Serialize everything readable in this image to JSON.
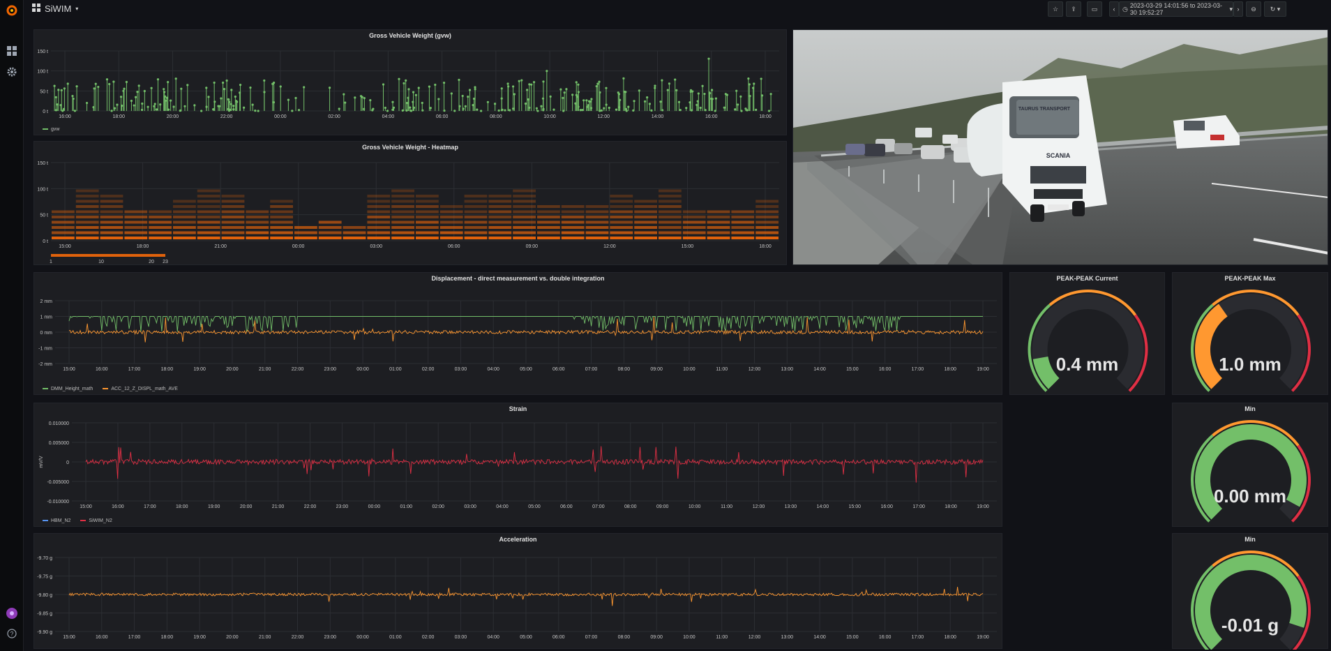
{
  "topbar": {
    "dashboard_title": "SiWIM",
    "time_range": "2023-03-29 14:01:56 to 2023-03-30 19:52:27"
  },
  "colors": {
    "green": "#73bf69",
    "orange": "#ff9830",
    "red": "#e02f44",
    "heat_orange": "#e0620c",
    "blue": "#5794f2"
  },
  "panels": {
    "gvw": {
      "title": "Gross Vehicle Weight (gvw)",
      "legend": [
        "gvw"
      ]
    },
    "heatmap": {
      "title": "Gross Vehicle Weight - Heatmap",
      "scale_labels": [
        "1",
        "10",
        "20",
        "23"
      ]
    },
    "displacement": {
      "title": "Displacement - direct measurement vs. double integration",
      "legend": [
        "DMM_Height_math",
        "ACC_12_Z_DISPL_math_AVE"
      ]
    },
    "peak_current": {
      "title": "PEAK-PEAK Current",
      "value": "0.4 mm",
      "fraction": 0.13
    },
    "peak_max": {
      "title": "PEAK-PEAK Max",
      "value": "1.0 mm",
      "fraction": 0.37
    },
    "strain": {
      "title": "Strain",
      "ylabel": "mV/V",
      "legend": [
        "HBM_N2",
        "SiWIM_N2"
      ]
    },
    "min_strain": {
      "title": "Min",
      "value": "0.00 mm",
      "fraction": 0.94
    },
    "acceleration": {
      "title": "Acceleration"
    },
    "min_acc": {
      "title": "Min",
      "value": "-0.01 g",
      "fraction": 0.9
    }
  },
  "chart_data": [
    {
      "type": "scatter",
      "title": "Gross Vehicle Weight (gvw)",
      "x_ticks": [
        "16:00",
        "18:00",
        "20:00",
        "22:00",
        "00:00",
        "02:00",
        "04:00",
        "06:00",
        "08:00",
        "10:00",
        "12:00",
        "14:00",
        "16:00",
        "18:00"
      ],
      "y_ticks": [
        "150 t",
        "100 t",
        "50 t",
        "0 t"
      ],
      "series": [
        {
          "name": "gvw"
        }
      ]
    },
    {
      "type": "heatmap",
      "title": "Gross Vehicle Weight - Heatmap",
      "x_ticks": [
        "15:00",
        "18:00",
        "21:00",
        "00:00",
        "03:00",
        "06:00",
        "09:00",
        "12:00",
        "15:00",
        "18:00"
      ],
      "y_ticks": [
        "150 t",
        "100 t",
        "50 t",
        "0 t"
      ],
      "color_scale": [
        "1",
        "10",
        "20",
        "23"
      ]
    },
    {
      "type": "line",
      "title": "Displacement - direct measurement vs. double integration",
      "x_ticks": [
        "15:00",
        "16:00",
        "17:00",
        "18:00",
        "19:00",
        "20:00",
        "21:00",
        "22:00",
        "23:00",
        "00:00",
        "01:00",
        "02:00",
        "03:00",
        "04:00",
        "05:00",
        "06:00",
        "07:00",
        "08:00",
        "09:00",
        "10:00",
        "11:00",
        "12:00",
        "13:00",
        "14:00",
        "15:00",
        "16:00",
        "17:00",
        "18:00",
        "19:00"
      ],
      "y_ticks": [
        "2 mm",
        "1 mm",
        "0 mm",
        "-1 mm",
        "-2 mm"
      ],
      "ylim": [
        -2,
        2
      ],
      "series": [
        {
          "name": "DMM_Height_math"
        },
        {
          "name": "ACC_12_Z_DISPL_math_AVE"
        }
      ]
    },
    {
      "type": "line",
      "title": "Strain",
      "ylabel": "mV/V",
      "x_ticks": [
        "15:00",
        "16:00",
        "17:00",
        "18:00",
        "19:00",
        "20:00",
        "21:00",
        "22:00",
        "23:00",
        "00:00",
        "01:00",
        "02:00",
        "03:00",
        "04:00",
        "05:00",
        "06:00",
        "07:00",
        "08:00",
        "09:00",
        "10:00",
        "11:00",
        "12:00",
        "13:00",
        "14:00",
        "15:00",
        "16:00",
        "17:00",
        "18:00",
        "19:00"
      ],
      "y_ticks": [
        "0.010000",
        "0.005000",
        "0",
        "-0.005000",
        "-0.010000"
      ],
      "ylim": [
        -0.01,
        0.01
      ],
      "series": [
        {
          "name": "HBM_N2"
        },
        {
          "name": "SiWIM_N2"
        }
      ]
    },
    {
      "type": "line",
      "title": "Acceleration",
      "x_ticks": [
        "15:00",
        "16:00",
        "17:00",
        "18:00",
        "19:00",
        "20:00",
        "21:00",
        "22:00",
        "23:00",
        "00:00",
        "01:00",
        "02:00",
        "03:00",
        "04:00",
        "05:00",
        "06:00",
        "07:00",
        "08:00",
        "09:00",
        "10:00",
        "11:00",
        "12:00",
        "13:00",
        "14:00",
        "15:00",
        "16:00",
        "17:00",
        "18:00",
        "19:00"
      ],
      "y_ticks": [
        "-9.70 g",
        "-9.75 g",
        "-9.80 g",
        "-9.85 g",
        "-9.90 g"
      ],
      "ylim": [
        -9.9,
        -9.7
      ]
    }
  ]
}
